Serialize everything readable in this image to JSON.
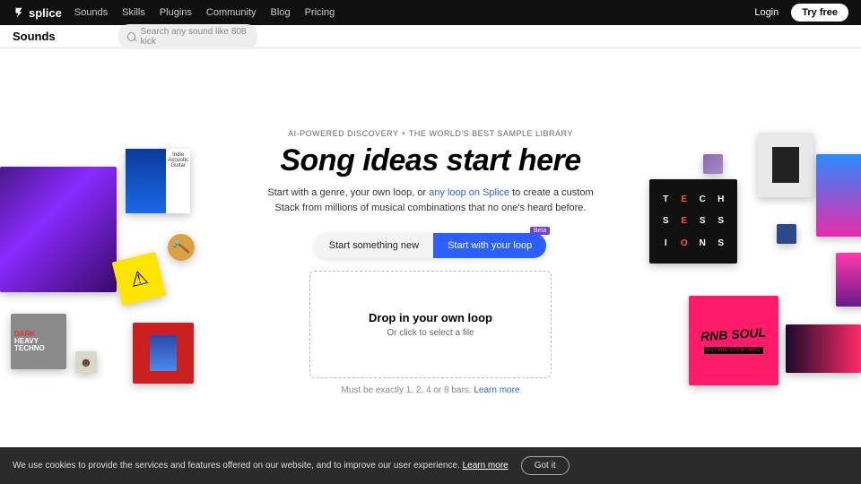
{
  "nav": {
    "brand": "splice",
    "links": [
      "Sounds",
      "Skills",
      "Plugins",
      "Community",
      "Blog",
      "Pricing"
    ],
    "login": "Login",
    "tryfree": "Try free"
  },
  "subbar": {
    "title": "Sounds",
    "search_placeholder": "Search any sound like 808 kick"
  },
  "hero": {
    "kicker": "AI-POWERED DISCOVERY + THE WORLD'S BEST SAMPLE LIBRARY",
    "headline": "Song ideas start here",
    "sub_pre": "Start with a genre, your own loop, or ",
    "sub_link": "any loop on Splice",
    "sub_post": " to create a custom Stack from millions of musical combinations that no one's heard before.",
    "cta1": "Start something new",
    "cta2": "Start with your loop",
    "beta": "Beta",
    "drop_title": "Drop in your own loop",
    "drop_sub": "Or click to select a file",
    "drop_note_pre": "Must be exactly 1, 2, 4 or 8 bars. ",
    "drop_note_link": "Learn more"
  },
  "tiles": {
    "t2_label1": "Indie",
    "t2_label2": "Acoustic",
    "t2_label3": "Guitar",
    "t5_l1": "DARK",
    "t5_l2": "HEAVY",
    "t5_l3": "TECHNO",
    "r4_letters": [
      "T",
      "E",
      "C",
      "H",
      "S",
      "E",
      "S",
      "S",
      "I",
      "O",
      "N",
      "S"
    ],
    "r6_big": "RNB SOUL",
    "r6_bar": "FUTURE SLOW JAMS"
  },
  "cookie": {
    "text": "We use cookies to provide the services and features offered on our website, and to improve our user experience. ",
    "learn": "Learn more",
    "gotit": "Got it"
  }
}
